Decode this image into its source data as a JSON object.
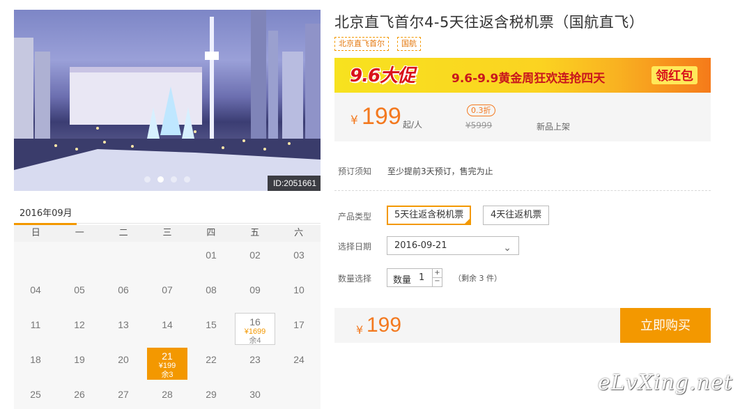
{
  "product": {
    "title": "北京直飞首尔4-5天往返含税机票（国航直飞）",
    "tags": [
      "北京直飞首尔",
      "国航"
    ],
    "photo_id": "ID:2051661"
  },
  "banner": {
    "logo": "9.6大促",
    "slogan": "9.6-9.9黄金周狂欢连抢四天",
    "cta": "领红包",
    "accent_colors": [
      "#f7e21f",
      "#f57a1a",
      "#d9121b"
    ]
  },
  "pricing": {
    "currency": "¥",
    "price": "199",
    "unit": "起/人",
    "discount": "0.3折",
    "original": "¥5999",
    "new_label": "新品上架"
  },
  "booking": {
    "notice_label": "预订须知",
    "notice_text": "至少提前3天预订，售完为止",
    "type_label": "产品类型",
    "types": [
      "5天往返含税机票",
      "4天往返机票"
    ],
    "date_label": "选择日期",
    "date_value": "2016-09-21",
    "qty_label": "数量选择",
    "qty_text": "数量",
    "qty_value": "1",
    "qty_plus": "+",
    "qty_minus": "−",
    "stock": "（剩余 3 件）"
  },
  "purchase": {
    "currency": "¥",
    "total": "199",
    "buy_label": "立即购买"
  },
  "calendar": {
    "month": "2016年09月",
    "weekdays": [
      "日",
      "一",
      "二",
      "三",
      "四",
      "五",
      "六"
    ],
    "weeks": [
      [
        null,
        null,
        null,
        null,
        {
          "day": "01"
        },
        {
          "day": "02"
        },
        {
          "day": "03"
        }
      ],
      [
        {
          "day": "04"
        },
        {
          "day": "05"
        },
        {
          "day": "06"
        },
        {
          "day": "07"
        },
        {
          "day": "08"
        },
        {
          "day": "09"
        },
        {
          "day": "10"
        }
      ],
      [
        {
          "day": "11"
        },
        {
          "day": "12"
        },
        {
          "day": "13"
        },
        {
          "day": "14"
        },
        {
          "day": "15"
        },
        {
          "day": "16",
          "price": "¥1699",
          "remain": "余4",
          "state": "avail"
        },
        {
          "day": "17"
        }
      ],
      [
        {
          "day": "18"
        },
        {
          "day": "19"
        },
        {
          "day": "20"
        },
        {
          "day": "21",
          "price": "¥199",
          "remain": "余3",
          "state": "selected"
        },
        {
          "day": "22"
        },
        {
          "day": "23"
        },
        {
          "day": "24"
        }
      ],
      [
        {
          "day": "25"
        },
        {
          "day": "26"
        },
        {
          "day": "27"
        },
        {
          "day": "28"
        },
        {
          "day": "29"
        },
        {
          "day": "30"
        },
        null
      ]
    ],
    "accent_color": "#f39800"
  },
  "watermark": "eLvXing.net"
}
